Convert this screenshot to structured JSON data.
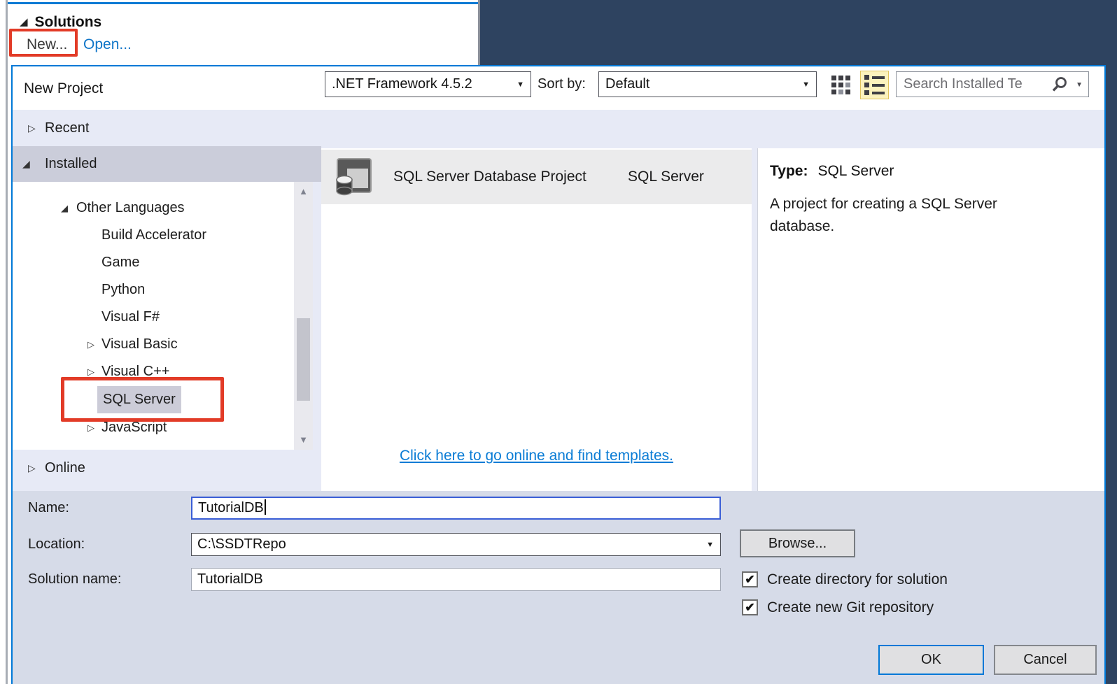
{
  "colors": {
    "annotation_red": "#e23b27",
    "dialog_border_blue": "#0079d7",
    "navy_background": "#2e4360",
    "link_blue": "#0a7cd5",
    "focus_blue": "#3a5ed6",
    "selected_category_gray": "#cbcdda",
    "panel_lavender": "#e7eaf6",
    "form_panel_blue_gray": "#d6dbe8",
    "selected_template_row": "#ebebec"
  },
  "glyphs": {
    "expanded": "◢",
    "collapsed": "▷",
    "dropdown_arrow": "▼",
    "scroll_up": "▲",
    "scroll_down": "▼",
    "check": "✔",
    "help": "?",
    "close": "✕"
  },
  "bg": {
    "solutions_label": "Solutions",
    "new_label": "New...",
    "open_label": "Open..."
  },
  "dialog": {
    "title": "New Project",
    "toolbar": {
      "framework_value": ".NET Framework 4.5.2",
      "sort_by_label": "Sort by:",
      "sort_value": "Default",
      "search_placeholder": "Search Installed Te"
    },
    "tree": {
      "recent_label": "Recent",
      "installed_label": "Installed",
      "online_label": "Online",
      "items": [
        {
          "label": "Other Languages"
        },
        {
          "label": "Build Accelerator"
        },
        {
          "label": "Game"
        },
        {
          "label": "Python"
        },
        {
          "label": "Visual F#"
        },
        {
          "label": "Visual Basic"
        },
        {
          "label": "Visual C++"
        },
        {
          "label": "SQL Server"
        },
        {
          "label": "JavaScript"
        }
      ]
    },
    "templates": {
      "item_name": "SQL Server Database Project",
      "item_type": "SQL Server",
      "online_link": "Click here to go online and find templates."
    },
    "info": {
      "type_label": "Type:",
      "type_value": "SQL Server",
      "description": "A project for creating a SQL Server database."
    },
    "form": {
      "name_label": "Name:",
      "name_value": "TutorialDB",
      "location_label": "Location:",
      "location_value": "C:\\SSDTRepo",
      "solution_label": "Solution name:",
      "solution_value": "TutorialDB",
      "browse_label": "Browse...",
      "create_dir_label": "Create directory for solution",
      "create_git_label": "Create new Git repository",
      "ok_label": "OK",
      "cancel_label": "Cancel"
    }
  }
}
